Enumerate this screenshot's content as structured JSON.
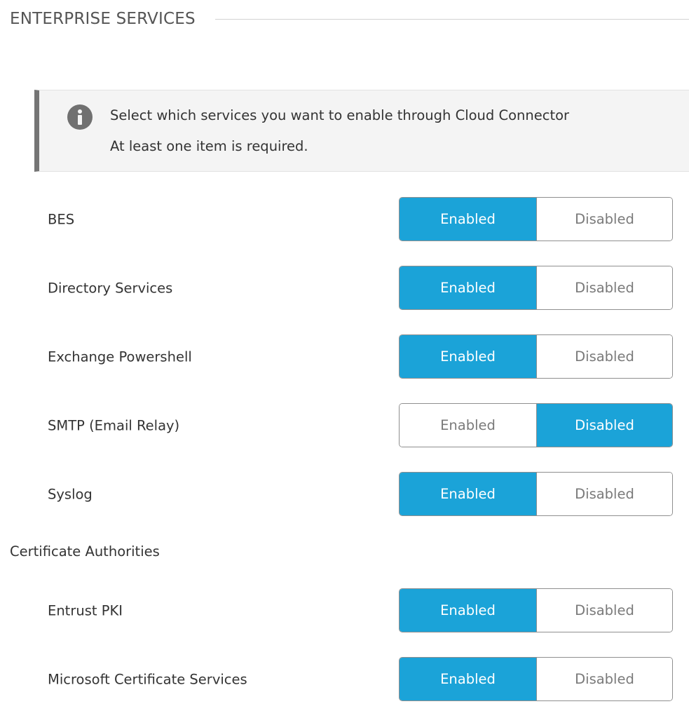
{
  "section": {
    "title": "ENTERPRISE SERVICES"
  },
  "info": {
    "icon": "info-icon",
    "line1": "Select which services you want to enable through Cloud Connector",
    "line2": "At least one item is required."
  },
  "toggle_labels": {
    "enabled": "Enabled",
    "disabled": "Disabled"
  },
  "services": [
    {
      "label": "BES",
      "state": "Enabled"
    },
    {
      "label": "Directory Services",
      "state": "Enabled"
    },
    {
      "label": "Exchange Powershell",
      "state": "Enabled"
    },
    {
      "label": "SMTP (Email Relay)",
      "state": "Disabled"
    },
    {
      "label": "Syslog",
      "state": "Enabled"
    }
  ],
  "certificate_authorities": {
    "title": "Certificate Authorities",
    "items": [
      {
        "label": "Entrust PKI",
        "state": "Enabled"
      },
      {
        "label": "Microsoft Certificate Services",
        "state": "Enabled"
      }
    ]
  },
  "colors": {
    "accent": "#1ba3d8",
    "info_border": "#757575",
    "info_background": "#f4f4f4"
  }
}
